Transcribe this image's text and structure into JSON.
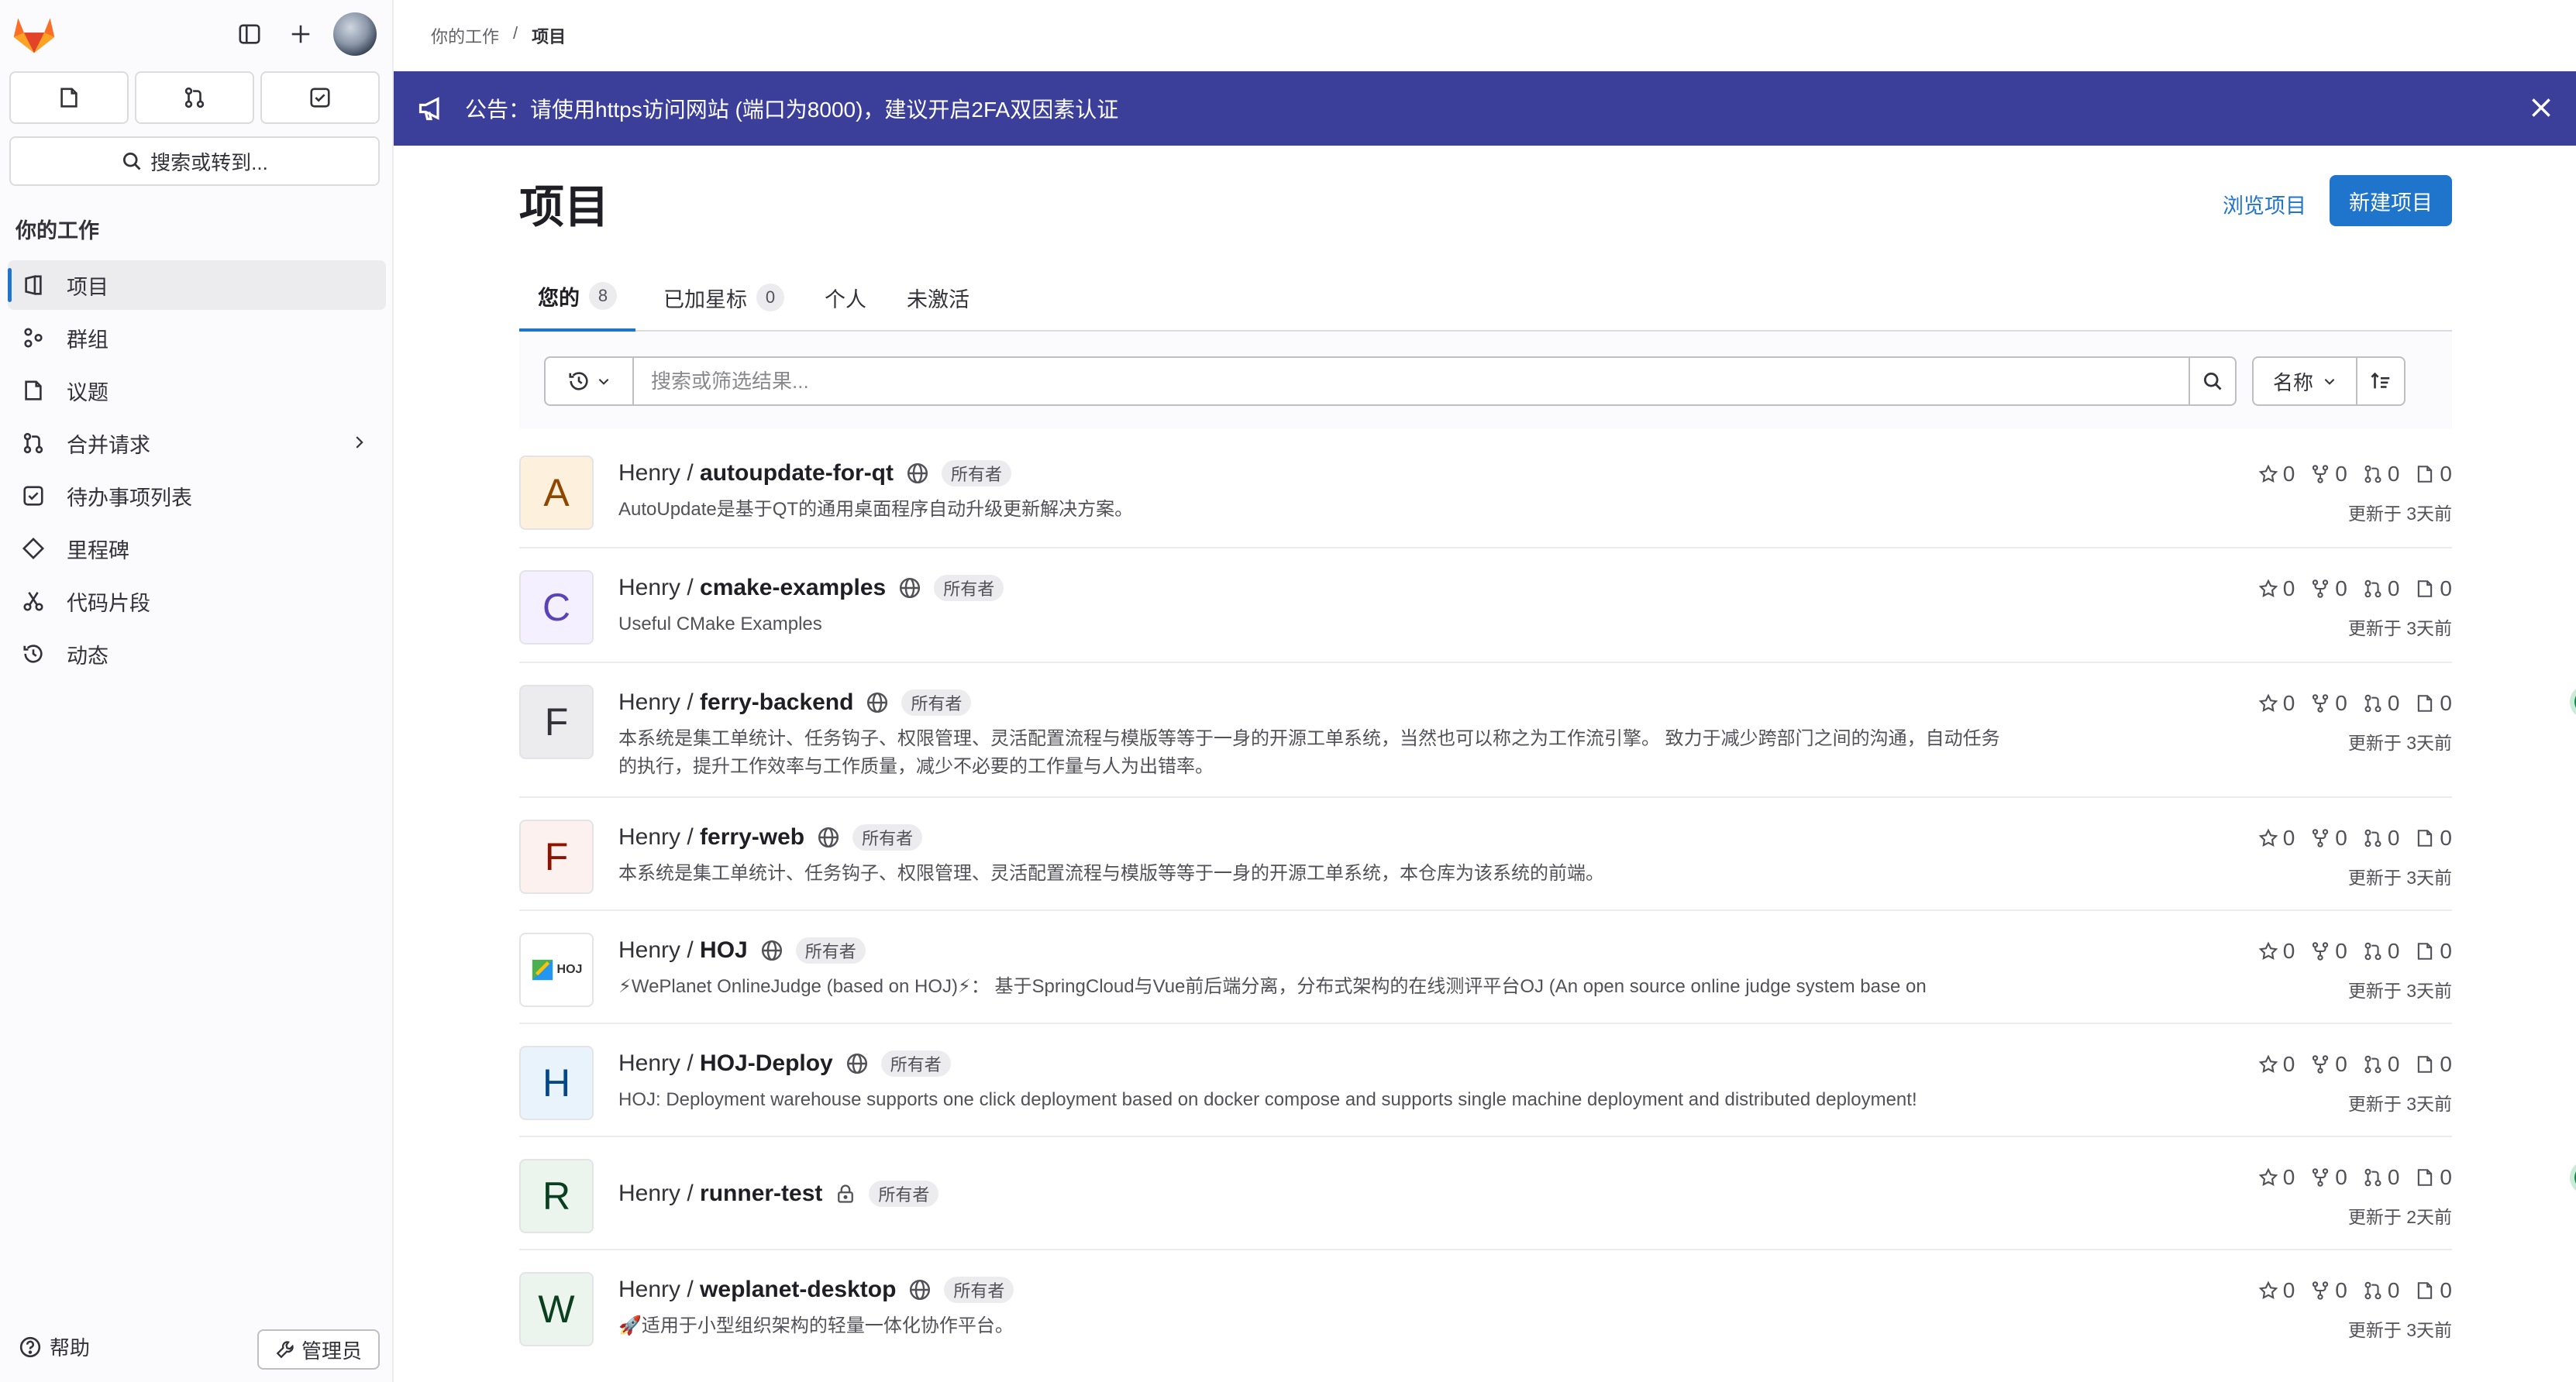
{
  "breadcrumb": {
    "parent": "你的工作",
    "separator": "/",
    "current": "项目"
  },
  "sidebar": {
    "search_label": "搜索或转到...",
    "section_title": "你的工作",
    "items": [
      {
        "label": "项目",
        "icon": "project-icon"
      },
      {
        "label": "群组",
        "icon": "group-icon"
      },
      {
        "label": "议题",
        "icon": "issue-icon"
      },
      {
        "label": "合并请求",
        "icon": "merge-request-icon"
      },
      {
        "label": "待办事项列表",
        "icon": "todo-icon"
      },
      {
        "label": "里程碑",
        "icon": "milestone-icon"
      },
      {
        "label": "代码片段",
        "icon": "snippet-icon"
      },
      {
        "label": "动态",
        "icon": "activity-icon"
      }
    ],
    "help_label": "帮助",
    "admin_label": "管理员"
  },
  "banner": {
    "text": "公告：请使用https访问网站 (端口为8000)，建议开启2FA双因素认证",
    "color": "#3b3f99"
  },
  "page": {
    "title": "项目",
    "browse_label": "浏览项目",
    "new_label": "新建项目"
  },
  "tabs": [
    {
      "label": "您的",
      "count": "8"
    },
    {
      "label": "已加星标",
      "count": "0"
    },
    {
      "label": "个人"
    },
    {
      "label": "未激活"
    }
  ],
  "filter": {
    "placeholder": "搜索或筛选结果...",
    "sort_label": "名称"
  },
  "projects": [
    {
      "initial": "A",
      "namespace": "Henry /",
      "name": "autoupdate-for-qt",
      "visibility": "public",
      "role": "所有者",
      "description": "AutoUpdate是基于QT的通用桌面程序自动升级更新解决方案。",
      "stars": "0",
      "forks": "0",
      "mrs": "0",
      "issues": "0",
      "updated": "更新于 3天前",
      "avatar_bg": "#fdf1dd",
      "avatar_fg": "#8f4700"
    },
    {
      "initial": "C",
      "namespace": "Henry /",
      "name": "cmake-examples",
      "visibility": "public",
      "role": "所有者",
      "description": "Useful CMake Examples",
      "stars": "0",
      "forks": "0",
      "mrs": "0",
      "issues": "0",
      "updated": "更新于 3天前",
      "avatar_bg": "#f4f0ff",
      "avatar_fg": "#5943b6"
    },
    {
      "initial": "F",
      "namespace": "Henry /",
      "name": "ferry-backend",
      "visibility": "public",
      "role": "所有者",
      "description": "本系统是集工单统计、任务钩子、权限管理、灵活配置流程与模版等等于一身的开源工单系统，当然也可以称之为工作流引擎。 致力于减少跨部门之间的沟通，自动任务的执行，提升工作效率与工作质量，减少不必要的工作量与人为出错率。",
      "stars": "0",
      "forks": "0",
      "mrs": "0",
      "issues": "0",
      "updated": "更新于 3天前",
      "pipeline": "passed",
      "avatar_bg": "#ececef",
      "avatar_fg": "#333238"
    },
    {
      "initial": "F",
      "namespace": "Henry /",
      "name": "ferry-web",
      "visibility": "public",
      "role": "所有者",
      "description": "本系统是集工单统计、任务钩子、权限管理、灵活配置流程与模版等等于一身的开源工单系统，本仓库为该系统的前端。",
      "stars": "0",
      "forks": "0",
      "mrs": "0",
      "issues": "0",
      "updated": "更新于 3天前",
      "avatar_bg": "#fcf1ef",
      "avatar_fg": "#8d1300"
    },
    {
      "initial": "HOJ",
      "namespace": "Henry /",
      "name": "HOJ",
      "visibility": "public",
      "role": "所有者",
      "description": "⚡WePlanet OnlineJudge (based on HOJ)⚡： 基于SpringCloud与Vue前后端分离，分布式架构的在线测评平台OJ (An open source online judge system base on",
      "stars": "0",
      "forks": "0",
      "mrs": "0",
      "issues": "0",
      "updated": "更新于 3天前"
    },
    {
      "initial": "H",
      "namespace": "Henry /",
      "name": "HOJ-Deploy",
      "visibility": "public",
      "role": "所有者",
      "description": "HOJ: Deployment warehouse supports one click deployment based on docker compose and supports single machine deployment and distributed deployment!",
      "stars": "0",
      "forks": "0",
      "mrs": "0",
      "issues": "0",
      "updated": "更新于 3天前",
      "avatar_bg": "#e9f3fc",
      "avatar_fg": "#064787"
    },
    {
      "initial": "R",
      "namespace": "Henry /",
      "name": "runner-test",
      "visibility": "private",
      "role": "所有者",
      "description": "",
      "stars": "0",
      "forks": "0",
      "mrs": "0",
      "issues": "0",
      "updated": "更新于 2天前",
      "pipeline": "passed",
      "avatar_bg": "#ecf4ee",
      "avatar_fg": "#0a4020"
    },
    {
      "initial": "W",
      "namespace": "Henry /",
      "name": "weplanet-desktop",
      "visibility": "public",
      "role": "所有者",
      "description": "🚀适用于小型组织架构的轻量一体化协作平台。",
      "stars": "0",
      "forks": "0",
      "mrs": "0",
      "issues": "0",
      "updated": "更新于 3天前",
      "avatar_bg": "#ecf4ee",
      "avatar_fg": "#0a4020"
    }
  ]
}
